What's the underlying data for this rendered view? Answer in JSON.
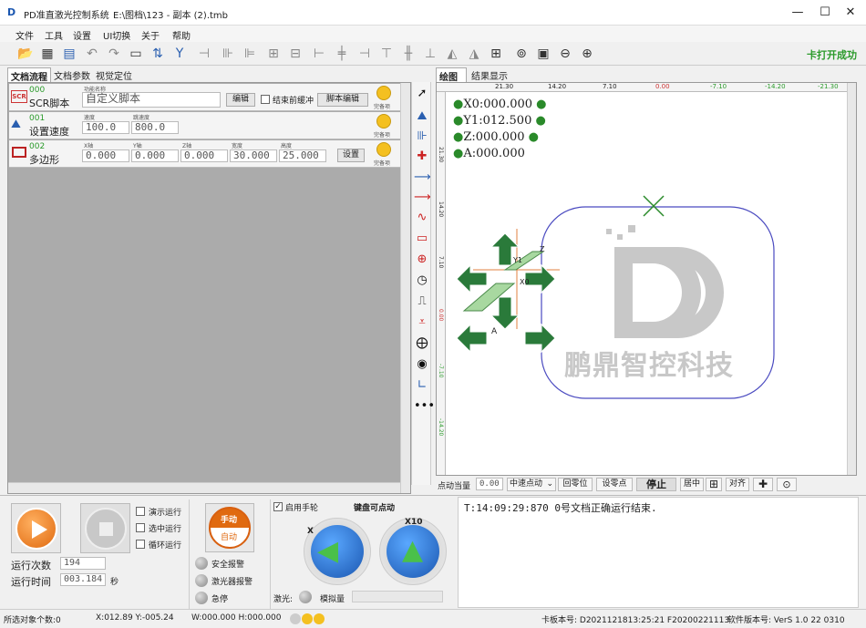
{
  "window": {
    "app_title": "PD准直激光控制系统",
    "file_path": "E:\\图档\\123 - 副本 (2).tmb",
    "minimize": "—",
    "maximize": "☐",
    "close": "✕"
  },
  "menu": [
    "文件",
    "工具",
    "设置",
    "UI切换",
    "关于",
    "帮助"
  ],
  "toolbar": {
    "status": "卡打开成功"
  },
  "left_tabs": [
    "文档流程",
    "文档参数",
    "视觉定位"
  ],
  "rows": [
    {
      "id": "000",
      "name": "SCR脚本",
      "icon": "SCR",
      "field_label": "功能名称",
      "field_value": "自定义脚本",
      "btn_edit": "编辑",
      "checkbox_label": "结束前缓冲",
      "btn_script": "脚本编辑",
      "done": "完备项"
    },
    {
      "id": "001",
      "name": "设置速度",
      "speed_label": "速度",
      "speed_value": "100.0",
      "jump_label": "跳速度",
      "jump_value": "800.0",
      "done": "完备项"
    },
    {
      "id": "002",
      "name": "多边形",
      "x_label": "X轴",
      "x_value": "0.000",
      "y_label": "Y轴",
      "y_value": "0.000",
      "z_label": "Z轴",
      "z_value": "0.000",
      "w_label": "宽度",
      "w_value": "30.000",
      "h_label": "高度",
      "h_value": "25.000",
      "btn_set": "设置",
      "done": "完备项"
    }
  ],
  "canvas_tabs": [
    "绘图",
    "结果显示"
  ],
  "ruler_top": [
    "21.30",
    "14.20",
    "7.10",
    "0.00",
    "-7.10",
    "-14.20",
    "-21.30"
  ],
  "ruler_left": [
    "21.30",
    "14.20",
    "7.10",
    "0.00",
    "-7.10",
    "-14.20"
  ],
  "coords": {
    "x": "X0:000.000",
    "y": "Y1:012.500",
    "z": "Z:000.000",
    "a": "A:000.000"
  },
  "pad_labels": {
    "x0": "X0",
    "y1": "Y1",
    "z": "Z",
    "a": "A"
  },
  "logo_text": "鹏鼎智控科技",
  "canvas_bar": {
    "jog_label": "点动当量",
    "jog_value": "0.00",
    "speed_mode": "中速点动",
    "speed_caret": "⌄",
    "home": "回零位",
    "set_zero": "设零点",
    "stop": "停止",
    "center": "居中",
    "align": "对齐"
  },
  "run": {
    "demo": "演示运行",
    "selected": "选中运行",
    "loop": "循环运行",
    "count_label": "运行次数",
    "count_value": "194",
    "time_label": "运行时间",
    "time_value": "003.184",
    "time_unit": "秒"
  },
  "mode": {
    "manual": "手动",
    "auto": "自动"
  },
  "alarms": {
    "safety": "安全报警",
    "laser": "激光器报警",
    "estop": "急停"
  },
  "handwheel": {
    "enable": "启用手轮",
    "keyboard": "键盘可点动",
    "dial1_axis": "X",
    "dial2_axis": "X10",
    "laser_label": "激光:",
    "analog": "模拟量"
  },
  "log": "T:14:09:29:870  0号文档正确运行结束.",
  "statusbar": {
    "selected": "所选对象个数:0",
    "xy": "X:012.89 Y:-005.24",
    "wh": "W:000.000 H:000.000",
    "card": "卡板本号: D2021121813:25:21 F20200221113",
    "soft": "软件版本号: VerS 1.0 22 0310"
  }
}
